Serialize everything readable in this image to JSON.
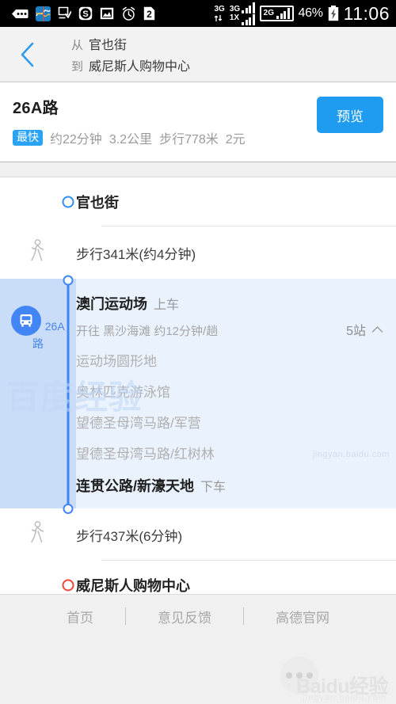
{
  "status_bar": {
    "icons": [
      "dots-pill-icon",
      "stocks-app-icon",
      "download-icon",
      "s-circle-icon",
      "photo-icon",
      "alarm-clock-icon",
      "sim-two-icon"
    ],
    "network_primary": "3G",
    "network_secondary_top": "3G",
    "network_secondary_bottom": "1X",
    "network_boxed": "2G",
    "battery_percent": "46%",
    "time": "11:06"
  },
  "header": {
    "back_icon": "chevron-left-icon",
    "from_prefix": "从",
    "from_value": "官也街",
    "to_prefix": "到",
    "to_value": "威尼斯人购物中心"
  },
  "route_card": {
    "title": "26A路",
    "badge": "最快",
    "duration": "约22分钟",
    "distance": "3.2公里",
    "walk": "步行778米",
    "fare": "2元",
    "preview_label": "预览"
  },
  "timeline": {
    "origin": "官也街",
    "walk_first": "步行341米(约4分钟)",
    "bus": {
      "line_name": "26A路",
      "board_stop": "澳门运动场",
      "board_tag": "上车",
      "headway": "开往 黑沙海滩 约12分钟/趟",
      "stop_count": "5站",
      "collapse_icon": "chevron-up-icon",
      "middle_stops": [
        "运动场圆形地",
        "奥林匹克游泳馆",
        "望德圣母湾马路/军营",
        "望德圣母湾马路/红树林"
      ],
      "alight_stop": "连贯公路/新濠天地",
      "alight_tag": "下车"
    },
    "walk_second": "步行437米(6分钟)",
    "destination": "威尼斯人购物中心"
  },
  "footer": {
    "links": [
      "首页",
      "意见反馈",
      "高德官网"
    ]
  },
  "watermark": {
    "bus_area": "百度经验",
    "side": "jingyan.baidu.com",
    "brand": "Baidu经验",
    "url": "jingyan.baidu.com"
  },
  "colors": {
    "accent_blue": "#1f9cf0",
    "bus_blue": "#4285f4",
    "badge_blue": "#2aa3f5",
    "destination_red": "#f2453d",
    "bus_panel_bg": "#eaf2fd",
    "bus_gutter_bg": "#c9ddf8"
  }
}
